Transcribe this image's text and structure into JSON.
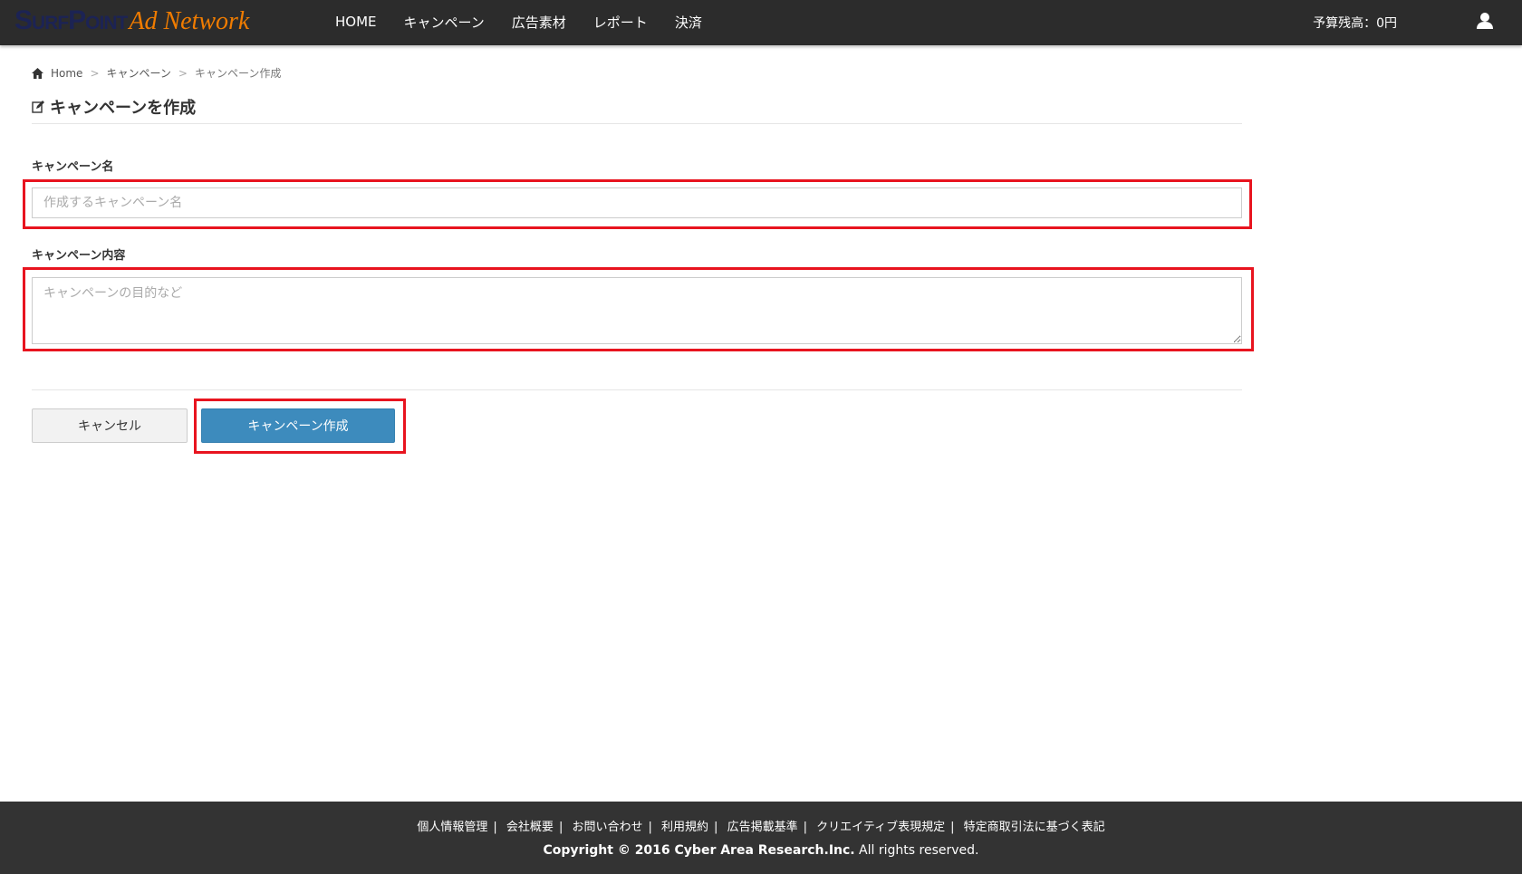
{
  "header": {
    "logo_part1": "SurfPoint",
    "logo_part2": "Ad Network",
    "menu": [
      "HOME",
      "キャンペーン",
      "広告素材",
      "レポート",
      "決済"
    ],
    "budget": "予算残高：0円"
  },
  "breadcrumb": [
    "Home",
    "キャンペーン",
    "キャンペーン作成"
  ],
  "breadcrumb_sep": ">",
  "page_title": "キャンペーンを作成",
  "form": {
    "name_label": "キャンペーン名",
    "name_placeholder": "作成するキャンペーン名",
    "name_value": "",
    "desc_label": "キャンペーン内容",
    "desc_placeholder": "キャンペーンの目的など",
    "desc_value": "",
    "cancel": "キャンセル",
    "create": "キャンペーン作成"
  },
  "footer": {
    "links": [
      "個人情報管理",
      "会社概要",
      "お問い合わせ",
      "利用規約",
      "広告掲載基準",
      "クリエイティブ表現規定",
      "特定商取引法に基づく表記"
    ],
    "sep": "|",
    "copyright_bold": "Copyright © 2016 Cyber Area Research.Inc.",
    "copyright_rest": " All rights reserved."
  },
  "colors": {
    "accent": "#3d8bbd",
    "highlight": "#e8141f",
    "nav_bg": "#2c2c2c"
  }
}
